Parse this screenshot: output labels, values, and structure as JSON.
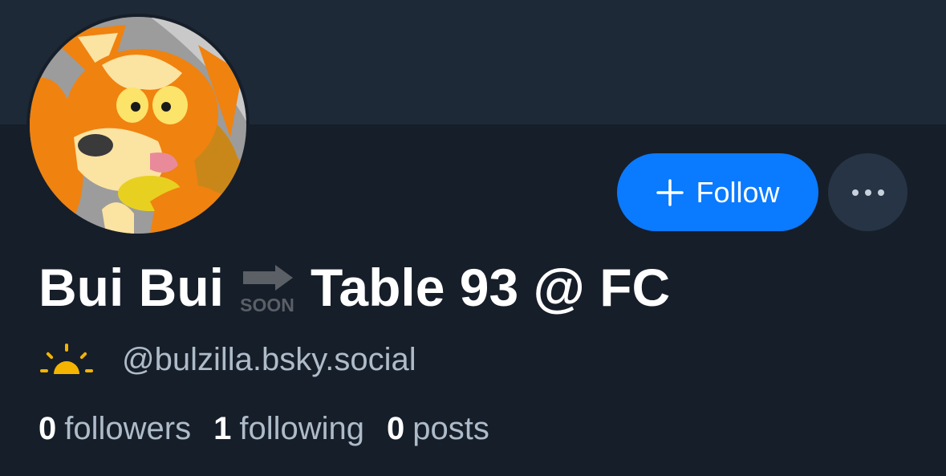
{
  "profile": {
    "name_part1": "Bui Bui",
    "soon_badge": "SOON",
    "name_part2": "Table 93 @ FC",
    "handle": "@bulzilla.bsky.social",
    "handle_emoji_icon": "sunrise-icon",
    "avatar_icon": "orange-fox-character-avatar"
  },
  "actions": {
    "follow_label": "Follow",
    "follow_icon": "plus-icon",
    "more_icon": "ellipsis-icon"
  },
  "stats": [
    {
      "count": "0",
      "label": "followers"
    },
    {
      "count": "1",
      "label": "following"
    },
    {
      "count": "0",
      "label": "posts"
    }
  ],
  "colors": {
    "background": "#161e29",
    "banner": "#1e2937",
    "accent": "#0a7aff",
    "secondary_button": "#273445",
    "muted_text": "#aebbc9"
  }
}
